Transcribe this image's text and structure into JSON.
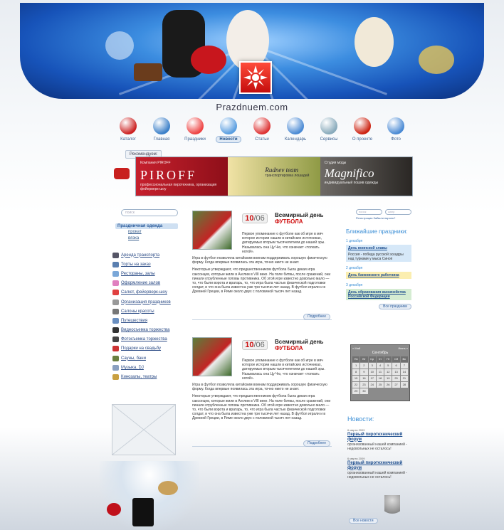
{
  "site": {
    "brand": "Prazdnuem.com"
  },
  "nav": [
    {
      "label": "Каталог",
      "icon": "catalog-icon",
      "color": "#c22"
    },
    {
      "label": "Главная",
      "icon": "home-icon",
      "color": "#3a7fc8"
    },
    {
      "label": "Праздники",
      "icon": "holidays-icon",
      "color": "#e44"
    },
    {
      "label": "Новости",
      "icon": "news-icon",
      "color": "#5a9ee0",
      "active": true
    },
    {
      "label": "Статьи",
      "icon": "articles-icon",
      "color": "#d33"
    },
    {
      "label": "Календарь",
      "icon": "calendar-icon",
      "color": "#4a8ad4"
    },
    {
      "label": "Сервисы",
      "icon": "services-icon",
      "color": "#8ab"
    },
    {
      "label": "О проекте",
      "icon": "about-icon",
      "color": "#c21"
    },
    {
      "label": "Фото",
      "icon": "photo-icon",
      "color": "#4a8ad4"
    }
  ],
  "tooltip": "Рекомендуем:",
  "ads": [
    {
      "small": "Компания PIROFF",
      "big": "PIROFF",
      "sub": "профессиональная пиротехника, организация фейерверк-шоу"
    },
    {
      "big": "Rudnev team",
      "sub": "транспортировка лошадей"
    },
    {
      "small": "Студия моды",
      "big": "Magnifico",
      "sub": "индивидуальный пошив одежды"
    }
  ],
  "left": {
    "search_placeholder": "поиск",
    "category": "Праздничная одежда",
    "subs": [
      "прокат",
      "вязка"
    ],
    "menu": [
      {
        "label": "Аренда транспорта",
        "icon": "car-icon",
        "color": "#556"
      },
      {
        "label": "Торты на заказ",
        "icon": "cake-icon",
        "color": "#5a7fb0"
      },
      {
        "label": "Рестораны, залы",
        "icon": "restaurant-icon",
        "color": "#7aa7d8"
      },
      {
        "label": "Оформление залов",
        "icon": "balloon-icon",
        "color": "#e080c0"
      },
      {
        "label": "Салют, фейерверк-шоу",
        "icon": "firework-icon",
        "color": "#e04040"
      },
      {
        "label": "Организация праздников",
        "icon": "party-icon",
        "color": "#999"
      },
      {
        "label": "Салоны красоты",
        "icon": "beauty-icon",
        "color": "#777"
      },
      {
        "label": "Путешествия",
        "icon": "travel-icon",
        "color": "#6a8fc0"
      },
      {
        "label": "Видеосъемка торжества",
        "icon": "video-icon",
        "color": "#333"
      },
      {
        "label": "Фотосъемка торжества",
        "icon": "camera-icon",
        "color": "#444"
      },
      {
        "label": "Подарки на свадьбу",
        "icon": "gift-icon",
        "color": "#c33"
      },
      {
        "label": "Сауны, бани",
        "icon": "sauna-icon",
        "color": "#6a8040"
      },
      {
        "label": "Музыка, DJ",
        "icon": "music-icon",
        "color": "#8aa0c0"
      },
      {
        "label": "Кинозалы, театры",
        "icon": "theater-icon",
        "color": "#c9a040"
      }
    ]
  },
  "articles": [
    {
      "day": "10",
      "month": "/06",
      "title_top": "Всемирный день",
      "title_red": "ФУТБОЛА",
      "lead": "Первое упоминание о футболе как об игре в мяч которое истории нашли в китайских источниках, датируемых вторым тысячелетием до нашей эры. Называлась она Цу Чю, что означает «толкать ногой».",
      "body1": "Игра в футбол позволяла китайским воинам поддерживать хорошую физическую форму. Когда впервые появилась эта игра, точно никто не знает.",
      "body2": "Некоторые утверждают, что предшественником футбола была дикая игра саксонцев, которые жили в Англии в VIII веке. На поле битвы, после сражений, они пинали отрубленные головы противника. Об этой игре известно довольно мало — то, что были ворота и вратарь, то, что игра была частью физической подготовки солдат, и что она была известна уже три тысячи лет назад. В футбол играли и в Древней Греции, в Риме около двух с половиной тысяч лет назад.",
      "more": "Подробнее"
    },
    {
      "day": "10",
      "month": "/06",
      "title_top": "Всемирный день",
      "title_red": "ФУТБОЛА",
      "lead": "Первое упоминание о футболе как об игре в мяч которое истории нашли в китайских источниках, датируемых вторым тысячелетием до нашей эры. Называлась она Цу Чю, что означает «толкать ногой».",
      "body1": "Игра в футбол позволяла китайским воинам поддерживать хорошую физическую форму. Когда впервые появилась эта игра, точно никто не знает.",
      "body2": "Некоторые утверждают, что предшественником футбола была дикая игра саксонцев, которые жили в Англии в VIII веке. На поле битвы, после сражений, они пинали отрубленные головы противника. Об этой игре известно довольно мало — то, что были ворота и вратарь, то, что игра была частью физической подготовки солдат, и что она была известна уже три тысячи лет назад. В футбол играли и в Древней Греции, в Риме около двух с половиной тысяч лет назад.",
      "more": "Подробнее"
    }
  ],
  "right": {
    "search_ph1": "поиск",
    "search_ph2": "жанр",
    "links": "Регистрация  Забыли пароль?",
    "holidays_head": "Ближайшие праздники:",
    "holidays": [
      {
        "date": "1 декабря",
        "bold": "День воинской славы",
        "text": "Россия - победа русской эскадры над турками у мыса Синоп",
        "bg": "#d6e8f8"
      },
      {
        "date": "2 декабря",
        "bold": "День банковского работника",
        "text": "",
        "bg": "#fbeeb0"
      },
      {
        "date": "3 декабря",
        "bold": "День образования казначейства Российской Федерации",
        "text": "",
        "bg": "#d5ecd2"
      }
    ],
    "all_holidays": "Все праздники",
    "calendar": {
      "prev": "« Май",
      "label": "Сентябрь",
      "next": "Июнь »",
      "weekdays": [
        "Пн",
        "Вт",
        "Ср",
        "Чт",
        "Пт",
        "Сб",
        "Вс"
      ],
      "days": [
        "1",
        "2",
        "3",
        "4",
        "5",
        "6",
        "7",
        "8",
        "9",
        "10",
        "11",
        "12",
        "13",
        "14",
        "15",
        "16",
        "17",
        "18",
        "19",
        "20",
        "21",
        "22",
        "23",
        "24",
        "25",
        "26",
        "27",
        "28",
        "29",
        "30"
      ]
    },
    "news_head": "Новости:",
    "news": [
      {
        "date": "6 марта 2009",
        "title": "Первый пиротехнический форум",
        "text": "организованный нашей компанией - недовольных не осталось!"
      },
      {
        "date": "6 марта 2009",
        "title": "Первый пиротехнический форум",
        "text": "организованный нашей компанией - недовольных не осталось!"
      }
    ],
    "all_news": "Все новости"
  }
}
